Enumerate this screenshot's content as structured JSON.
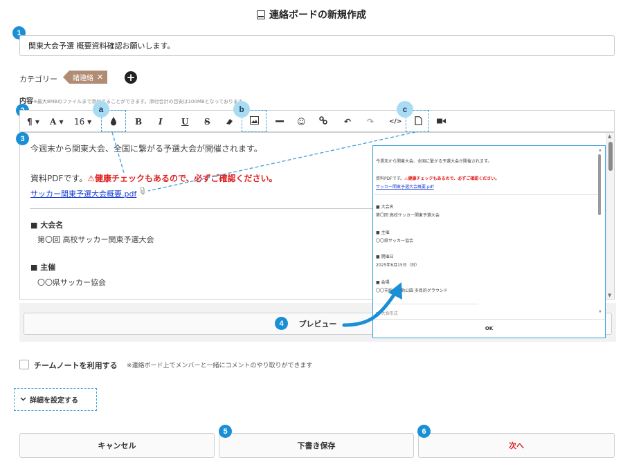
{
  "header": {
    "title": "連絡ボードの新規作成",
    "icon": "document-icon"
  },
  "badges": {
    "b1": "1",
    "b2": "2",
    "b3": "3",
    "b4": "4",
    "b5": "5",
    "b6": "6",
    "ca": "a",
    "cb": "b",
    "cc": "c"
  },
  "title_input": {
    "value": "関東大会予選 概要資料確認お願いします。"
  },
  "category": {
    "label": "カテゴリー",
    "tag": "諸連絡",
    "remove": "✕",
    "add": "+"
  },
  "content": {
    "label": "内容",
    "note": "※最大8MBのファイルまで添付することができます。添付合計の目安は100MBとなっております。"
  },
  "toolbar": {
    "paragraph": "¶ ▾",
    "font": "A ▾",
    "size": "16 ▾",
    "bold": "B",
    "italic": "I",
    "underline": "U",
    "strike": "S",
    "undo": "↶",
    "redo": "↷",
    "code": "</>"
  },
  "editor": {
    "line1": "今週末から関東大会、全国に繋がる予選大会が開催されます。",
    "line2_prefix": "資料PDFです。",
    "line2_warn": "⚠健康チェックもあるので、必ずご確認ください。",
    "link": "サッカー関東予選大会概要.pdf",
    "sec1_head": "■ 大会名",
    "sec1_val": "第〇回 高校サッカー関東予選大会",
    "sec2_head": "■ 主催",
    "sec2_val": "〇〇県サッカー協会"
  },
  "preview": {
    "button": "プレビュー",
    "line1": "今週末から関東大会、全国に繋がる予選大会が開催されます。",
    "line2_prefix": "資料PDFです。",
    "line2_warn": "⚠健康チェックもあるので、必ずご確認ください。",
    "link": "サッカー関東予選大会概要.pdf",
    "s1h": "■ 大会名",
    "s1v": "第〇回 高校サッカー関東予選大会",
    "s2h": "■ 主催",
    "s2v": "〇〇県サッカー協会",
    "s3h": "■ 開催日",
    "s3v": "2025年6月15日（日）",
    "s4h": "■ 会場",
    "s4v": "〇〇市総合運動公園 多目的グラウンド",
    "s5h": "■ 大会形式",
    "ok": "OK"
  },
  "team_note": {
    "label": "チームノートを利用する",
    "note": "※連絡ボード上でメンバーと一緒にコメントのやり取りができます"
  },
  "detail": {
    "label": "詳細を設定する"
  },
  "buttons": {
    "cancel": "キャンセル",
    "draft": "下書き保存",
    "next": "次へ"
  },
  "colors": {
    "accent": "#1a8fd6",
    "warn": "#e02020",
    "link": "#1a3fd6",
    "tag": "#b08c74"
  }
}
